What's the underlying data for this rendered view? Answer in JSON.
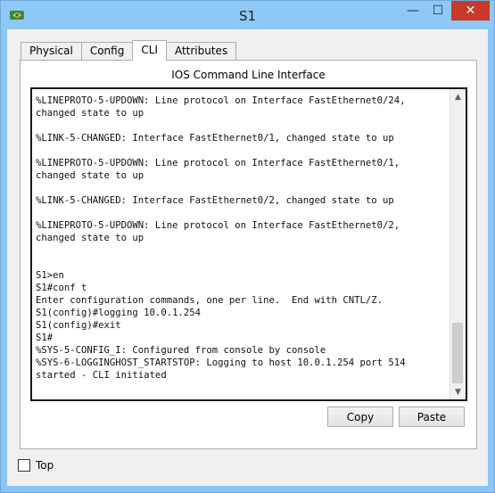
{
  "window": {
    "title": "S1",
    "minimize_glyph": "—",
    "maximize_glyph": "☐",
    "close_glyph": "✕",
    "icon": "packet-tracer-switch-icon",
    "accent_color": "#8ec8f6",
    "close_color": "#c7392a"
  },
  "tabs": [
    {
      "label": "Physical",
      "active": false
    },
    {
      "label": "Config",
      "active": false
    },
    {
      "label": "CLI",
      "active": true
    },
    {
      "label": "Attributes",
      "active": false
    }
  ],
  "panel": {
    "title": "IOS Command Line Interface"
  },
  "terminal": {
    "lines": [
      "%LINEPROTO-5-UPDOWN: Line protocol on Interface FastEthernet0/24,",
      "changed state to up",
      "",
      "%LINK-5-CHANGED: Interface FastEthernet0/1, changed state to up",
      "",
      "%LINEPROTO-5-UPDOWN: Line protocol on Interface FastEthernet0/1,",
      "changed state to up",
      "",
      "%LINK-5-CHANGED: Interface FastEthernet0/2, changed state to up",
      "",
      "%LINEPROTO-5-UPDOWN: Line protocol on Interface FastEthernet0/2,",
      "changed state to up",
      "",
      "",
      "S1>en",
      "S1#conf t",
      "Enter configuration commands, one per line.  End with CNTL/Z.",
      "S1(config)#logging 10.0.1.254",
      "S1(config)#exit",
      "S1#",
      "%SYS-5-CONFIG_I: Configured from console by console",
      "%SYS-6-LOGGINGHOST_STARTSTOP: Logging to host 10.0.1.254 port 514",
      "started - CLI initiated"
    ]
  },
  "buttons": {
    "copy_label": "Copy",
    "paste_label": "Paste"
  },
  "footer": {
    "top_label": "Top",
    "top_checked": false
  }
}
